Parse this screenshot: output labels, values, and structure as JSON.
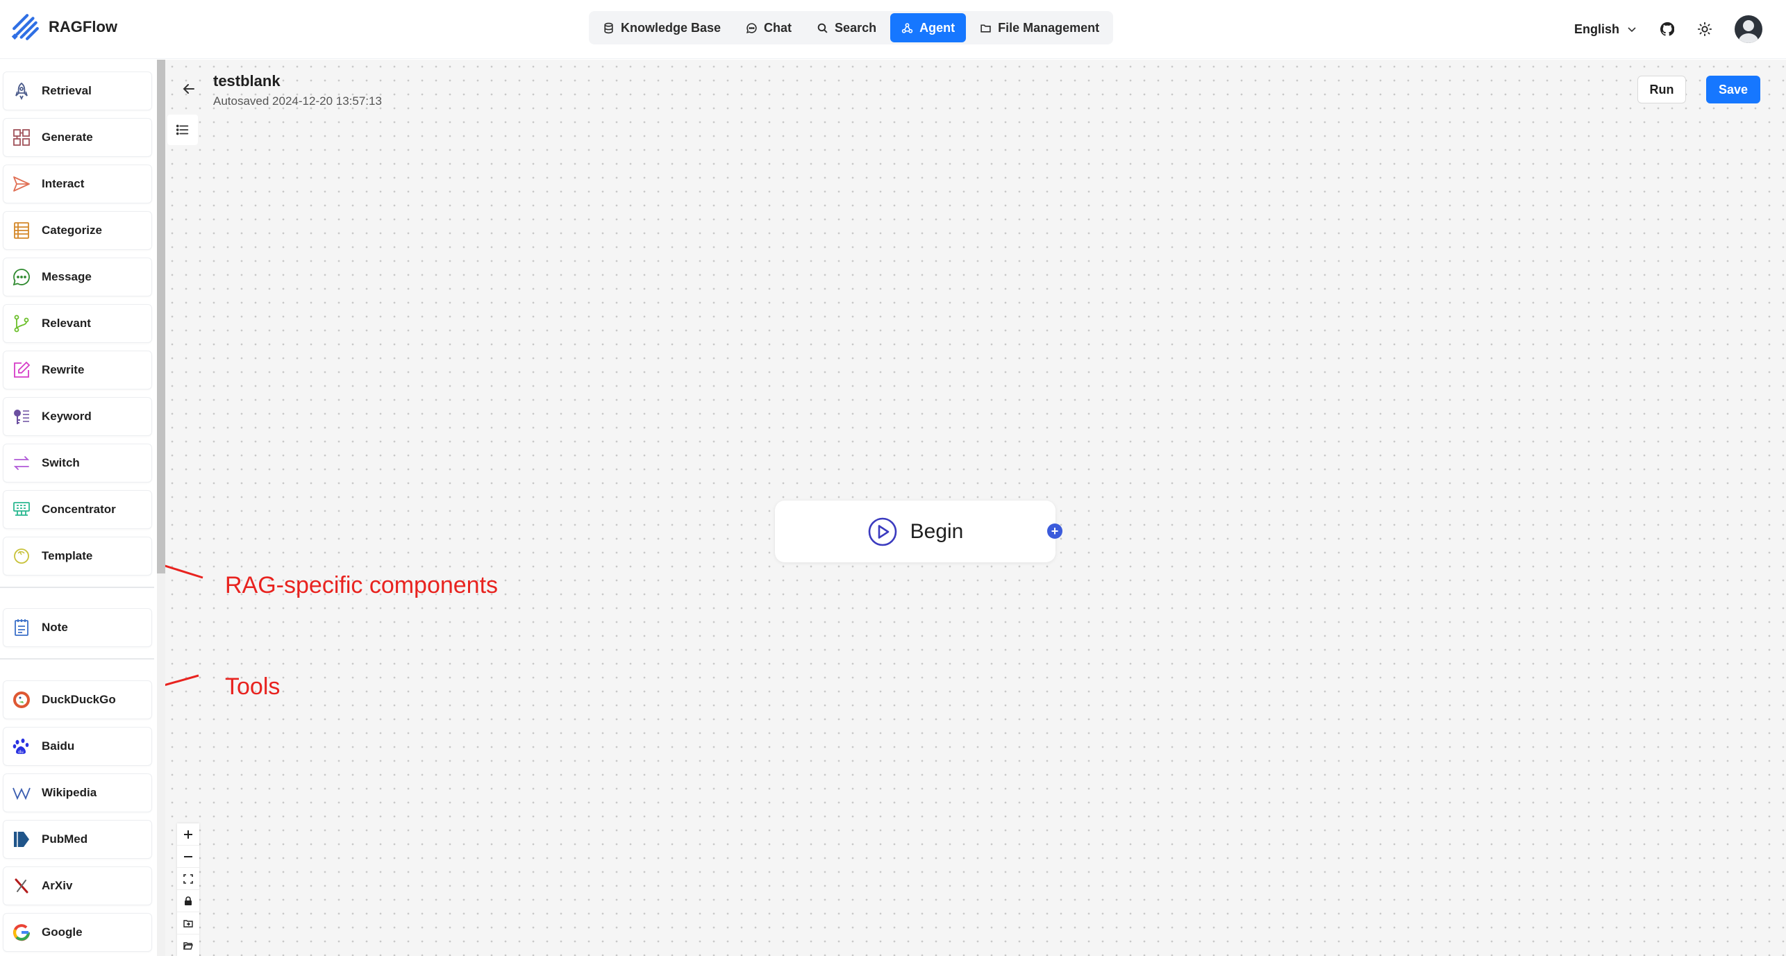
{
  "app": {
    "name": "RAGFlow"
  },
  "nav": [
    {
      "label": "Knowledge Base",
      "icon": "database-icon"
    },
    {
      "label": "Chat",
      "icon": "chat-icon"
    },
    {
      "label": "Search",
      "icon": "search-icon"
    },
    {
      "label": "Agent",
      "icon": "agent-icon",
      "active": true
    },
    {
      "label": "File Management",
      "icon": "folder-icon"
    }
  ],
  "header": {
    "language": "English"
  },
  "sidebar": {
    "components": [
      {
        "label": "Retrieval",
        "icon": "rocket-icon"
      },
      {
        "label": "Generate",
        "icon": "generate-icon"
      },
      {
        "label": "Interact",
        "icon": "send-icon"
      },
      {
        "label": "Categorize",
        "icon": "list-icon"
      },
      {
        "label": "Message",
        "icon": "message-icon"
      },
      {
        "label": "Relevant",
        "icon": "branch-icon"
      },
      {
        "label": "Rewrite",
        "icon": "edit-icon"
      },
      {
        "label": "Keyword",
        "icon": "keyword-icon"
      },
      {
        "label": "Switch",
        "icon": "switch-icon"
      },
      {
        "label": "Concentrator",
        "icon": "concentrator-icon"
      },
      {
        "label": "Template",
        "icon": "template-icon"
      }
    ],
    "notes": [
      {
        "label": "Note",
        "icon": "note-icon"
      }
    ],
    "tools": [
      {
        "label": "DuckDuckGo",
        "icon": "duckduckgo-icon"
      },
      {
        "label": "Baidu",
        "icon": "baidu-icon"
      },
      {
        "label": "Wikipedia",
        "icon": "wikipedia-icon"
      },
      {
        "label": "PubMed",
        "icon": "pubmed-icon"
      },
      {
        "label": "ArXiv",
        "icon": "arxiv-icon"
      },
      {
        "label": "Google",
        "icon": "google-icon"
      }
    ]
  },
  "flow": {
    "title": "testblank",
    "autosaved": "Autosaved 2024-12-20 13:57:13",
    "run_label": "Run",
    "save_label": "Save",
    "begin_node": "Begin"
  },
  "annotations": {
    "rag": "RAG-specific components",
    "tools": "Tools"
  },
  "colors": {
    "accent": "#1677ff",
    "annotation": "#e8231f",
    "handle": "#3b5bdb"
  }
}
